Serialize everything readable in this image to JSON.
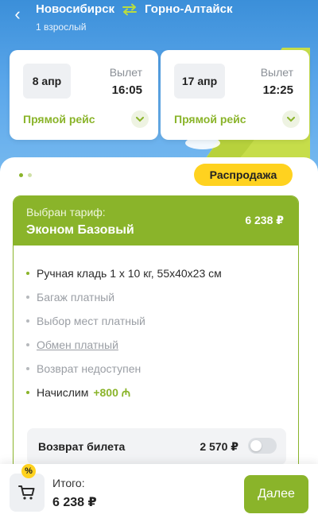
{
  "header": {
    "origin": "Новосибирск",
    "destination": "Горно-Алтайск",
    "passengers": "1 взрослый",
    "back_icon": "‹"
  },
  "flights": [
    {
      "date": "8 апр",
      "departure_label": "Вылет",
      "departure_time": "16:05",
      "type": "Прямой рейс"
    },
    {
      "date": "17 апр",
      "departure_label": "Вылет",
      "departure_time": "12:25",
      "type": "Прямой рейс"
    }
  ],
  "badge": {
    "sale": "Распродажа"
  },
  "tariff": {
    "caption": "Выбран тариф:",
    "name": "Эконом Базовый",
    "price": "6 238 ₽",
    "features": [
      "Ручная кладь 1 x 10 кг, 55x40x23 см",
      "Багаж платный",
      "Выбор мест платный",
      "Обмен платный",
      "Возврат недоступен",
      "Начислим"
    ],
    "bonus": "+800 ₼"
  },
  "refund": {
    "label": "Возврат билета",
    "price": "2 570 ₽",
    "enabled": false
  },
  "footer": {
    "promo_icon": "%",
    "total_label": "Итого:",
    "total_value": "6 238 ₽",
    "next_label": "Далее"
  },
  "colors": {
    "accent_green": "#8ab42a",
    "sale_yellow": "#ffd21f",
    "sky_blue": "#5aa6ea"
  }
}
